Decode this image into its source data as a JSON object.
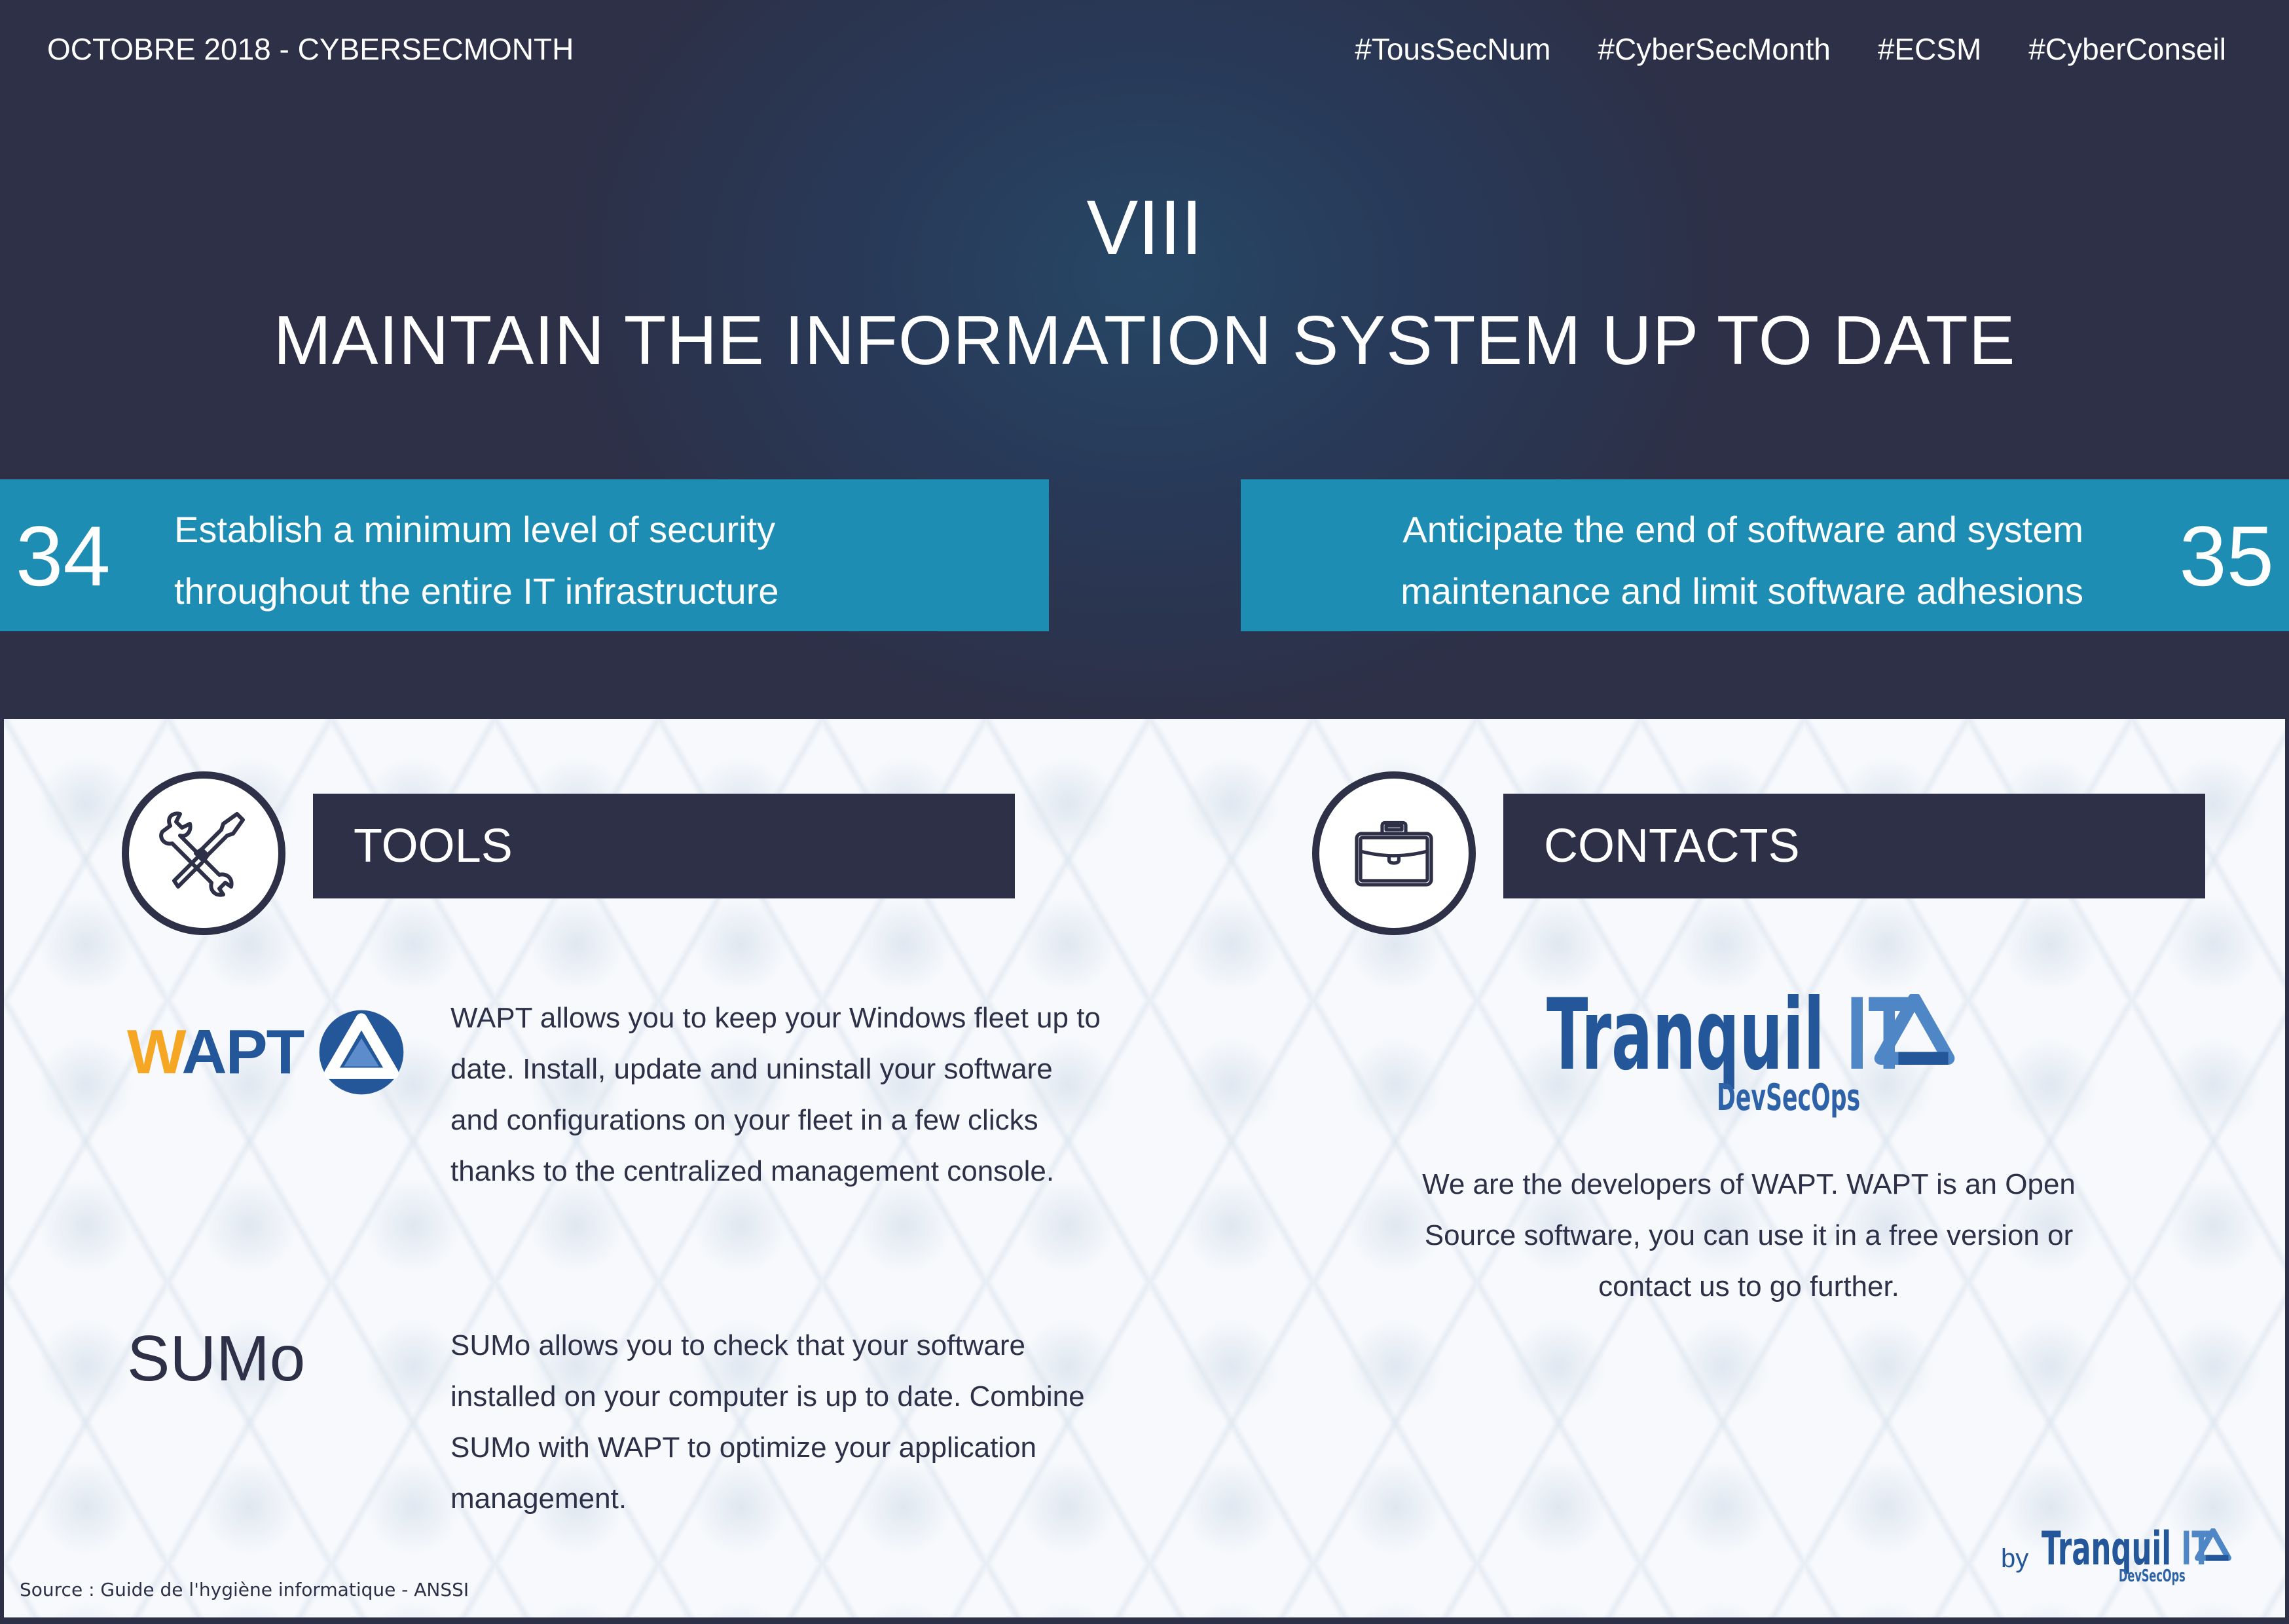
{
  "header": {
    "event_label": "OCTOBRE 2018 - CYBERSECMONTH",
    "hashtags": [
      "#TousSecNum",
      "#CyberSecMonth",
      "#ECSM",
      "#CyberConseil"
    ]
  },
  "chapter": {
    "numeral": "VIII",
    "title": "MAINTAIN THE INFORMATION SYSTEM UP TO DATE"
  },
  "rules": [
    {
      "number": "34",
      "lines": [
        "Establish a minimum level of security",
        "throughout the entire IT infrastructure"
      ]
    },
    {
      "number": "35",
      "lines": [
        "Anticipate the end of software and system",
        "maintenance and limit software adhesions"
      ]
    }
  ],
  "tools": {
    "heading": "TOOLS",
    "icon": "wrench-screwdriver-icon",
    "items": [
      {
        "name": "WAPT",
        "logo_first_letter": "W",
        "logo_rest": "APT",
        "lines": [
          "WAPT allows you to keep your Windows fleet up to",
          "date. Install, update and uninstall your software",
          "and configurations on your fleet in a few clicks",
          "thanks to the centralized management console."
        ]
      },
      {
        "name": "SUMo",
        "lines": [
          "SUMo allows you to check that your software",
          "installed on your computer is up to date. Combine",
          "SUMo with WAPT to optimize your application",
          "management."
        ]
      }
    ]
  },
  "contacts": {
    "heading": "CONTACTS",
    "icon": "briefcase-icon",
    "company": {
      "name_main": "Tranquil",
      "name_it": "IT",
      "tagline": "DevSecOps"
    },
    "lines": [
      "We are the developers of WAPT. WAPT is an Open",
      "Source software, you can use it in a free version or",
      "contact us to go further."
    ]
  },
  "footer": {
    "source": "Source : Guide de l'hygiène informatique - ANSSI",
    "by": "by",
    "brand_main": "Tranquil",
    "brand_it": "IT",
    "brand_tagline": "DevSecOps"
  },
  "colors": {
    "navy": "#2d3047",
    "teal": "#1d8db3",
    "wapt_orange": "#f5a623",
    "brand_blue": "#23579a",
    "brand_light_blue": "#4f87c6"
  }
}
